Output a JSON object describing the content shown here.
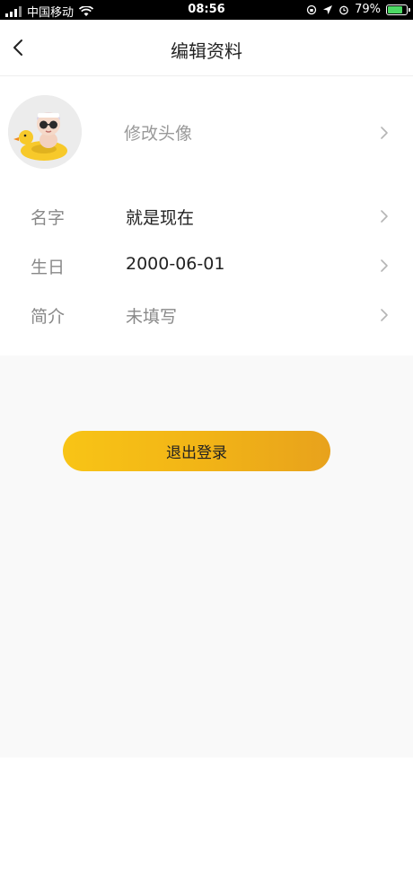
{
  "status_bar": {
    "carrier": "中国移动",
    "time": "08:56",
    "battery": "79%",
    "battery_level": 0.79
  },
  "nav": {
    "title": "编辑资料"
  },
  "avatar_row": {
    "label": "修改头像"
  },
  "fields": [
    {
      "label": "名字",
      "value": "就是现在"
    },
    {
      "label": "生日",
      "value": "2000-06-01"
    },
    {
      "label": "简介",
      "value": "未填写"
    }
  ],
  "actions": {
    "logout": "退出登录"
  },
  "colors": {
    "accent": "#f2b516",
    "background_grey": "#f9f9f9"
  }
}
